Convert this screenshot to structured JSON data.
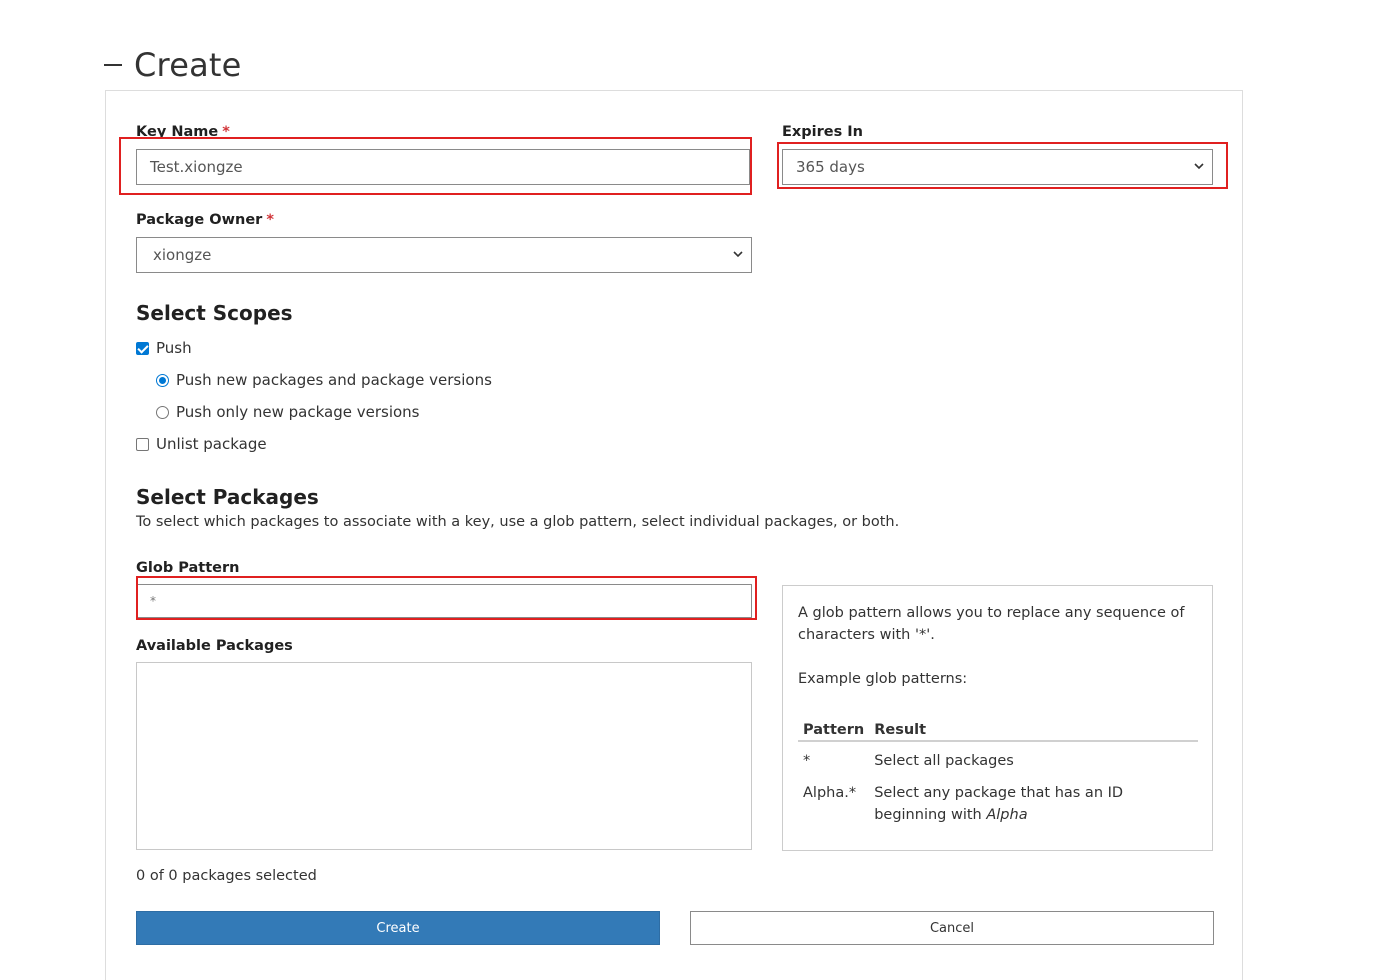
{
  "header": {
    "title": "Create"
  },
  "form": {
    "key_name": {
      "label": "Key Name",
      "required_mark": "*",
      "value": "Test.xiongze"
    },
    "expires_in": {
      "label": "Expires In",
      "selected": "365 days"
    },
    "package_owner": {
      "label": "Package Owner",
      "required_mark": "*",
      "selected": "xiongze"
    },
    "scopes": {
      "heading": "Select Scopes",
      "push": {
        "label": "Push",
        "checked": true
      },
      "push_new_and_versions": {
        "label": "Push new packages and package versions",
        "selected": true
      },
      "push_only_versions": {
        "label": "Push only new package versions",
        "selected": false
      },
      "unlist": {
        "label": "Unlist package",
        "checked": false
      }
    },
    "packages": {
      "heading": "Select Packages",
      "description": "To select which packages to associate with a key, use a glob pattern, select individual packages, or both.",
      "glob_label": "Glob Pattern",
      "glob_value": "*",
      "available_label": "Available Packages",
      "selection_count": "0 of 0 packages selected"
    },
    "help": {
      "intro": "A glob pattern allows you to replace any sequence of characters with '*'.",
      "examples_label": "Example glob patterns:",
      "col_pattern": "Pattern",
      "col_result": "Result",
      "rows": [
        {
          "pattern": "*",
          "result": "Select all packages"
        },
        {
          "pattern": "Alpha.*",
          "result_prefix": "Select any package that has an ID beginning with ",
          "result_emph": "Alpha"
        }
      ]
    },
    "buttons": {
      "create": "Create",
      "cancel": "Cancel"
    }
  },
  "colors": {
    "primary": "#337ab7",
    "highlight": "#e02020",
    "required": "#d13438",
    "check": "#0078d4"
  }
}
